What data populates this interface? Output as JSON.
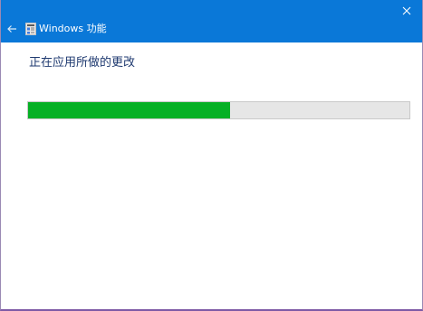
{
  "window": {
    "title": "Windows 功能",
    "accent_color": "#0a78d8",
    "back_icon": "back-arrow-icon",
    "app_icon": "windows-features-icon",
    "close_icon": "close-icon"
  },
  "main": {
    "heading": "正在应用所做的更改",
    "progress": {
      "fraction": 0.53,
      "fill_color": "#06b025"
    }
  }
}
